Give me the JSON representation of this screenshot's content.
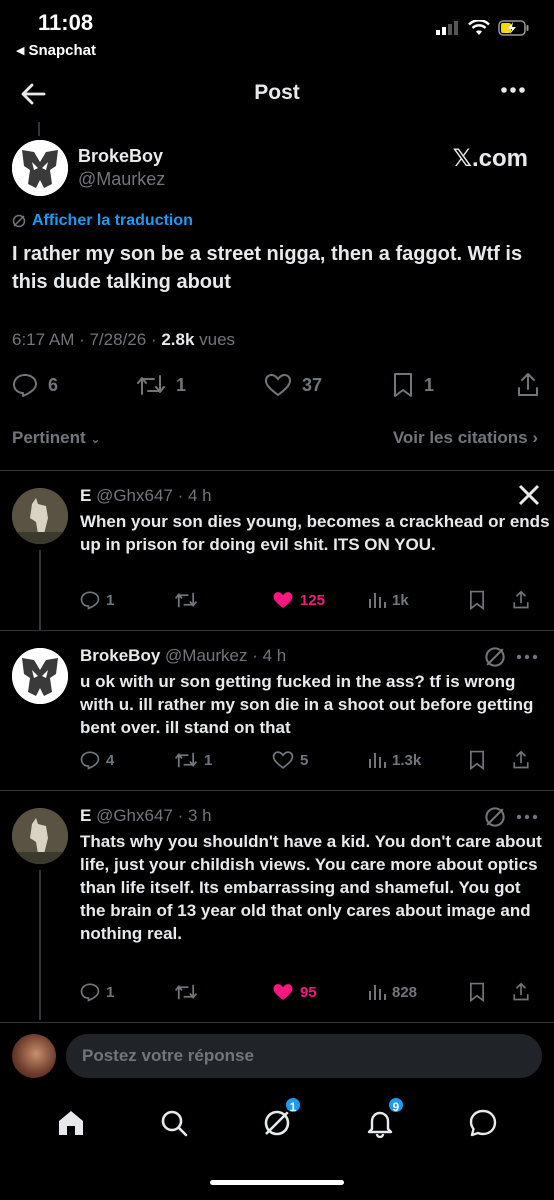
{
  "status": {
    "time": "11:08",
    "back_app": "Snapchat",
    "battery_icon": "battery-charging-icon"
  },
  "header": {
    "title": "Post"
  },
  "post": {
    "name": "BrokeBoy",
    "handle": "@Maurkez",
    "source": "𝕏.com",
    "translate": "Afficher la traduction",
    "text": "I rather my son be a street nigga, then a faggot. Wtf is this dude talking about",
    "time": "6:17 AM · 7/28/26 · ",
    "views_count": "2.8k",
    "views_label": " vues",
    "replies": "6",
    "reposts": "1",
    "likes": "37",
    "bookmarks": "1"
  },
  "sort": {
    "label": "Pertinent",
    "citations": "Voir les citations"
  },
  "replies": [
    {
      "name": "E",
      "handle": "@Ghx647 · 4 h",
      "text": "When your son dies young, becomes a crackhead or ends up in prison for doing evil shit. ITS ON YOU.",
      "replies": "1",
      "reposts": "",
      "likes": "125",
      "views": "1k",
      "liked": true
    },
    {
      "name": "BrokeBoy",
      "handle": "@Maurkez · 4 h",
      "text": "u ok with ur son getting fucked in the ass? tf is wrong with u. ill rather my son die in a shoot out before getting bent over. ill stand on that",
      "replies": "4",
      "reposts": "1",
      "likes": "5",
      "views": "1.3k",
      "liked": false
    },
    {
      "name": "E",
      "handle": "@Ghx647 · 3 h",
      "text": "Thats why you shouldn't have a kid. You don't care about life, just your childish views. You care more about optics than life itself. Its embarrassing and shameful. You got the brain of 13 year old that only cares about image and nothing real.",
      "replies": "1",
      "reposts": "",
      "likes": "95",
      "views": "828",
      "liked": true
    }
  ],
  "compose": {
    "placeholder": "Postez votre réponse"
  },
  "tabs": {
    "grok_badge": "1",
    "notif_badge": "9"
  },
  "colors": {
    "accent": "#1d9bf0",
    "like": "#f91880",
    "muted": "#71767b"
  }
}
